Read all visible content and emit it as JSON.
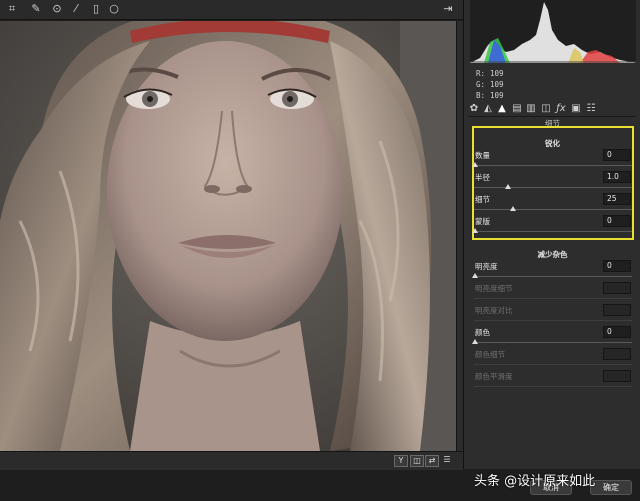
{
  "toolbar": {
    "tools": [
      "crop-icon",
      "eyedropper-icon",
      "red-eye-icon",
      "brush-icon",
      "gradient-icon",
      "radial-filter-icon"
    ],
    "export_icon": "export-icon"
  },
  "readout": {
    "r_label": "R:",
    "r_value": "109",
    "g_label": "G:",
    "g_value": "109",
    "b_label": "B:",
    "b_value": "109"
  },
  "panel": {
    "heading": "细节",
    "tabs": [
      "basic-icon",
      "tone-curve-icon",
      "detail-icon",
      "hsl-icon",
      "split-toning-icon",
      "lens-icon",
      "fx-icon",
      "camera-calibration-icon",
      "presets-icon"
    ]
  },
  "sharpening": {
    "title": "锐化",
    "params": [
      {
        "label": "数量",
        "value": "0",
        "level": 0.0
      },
      {
        "label": "半径",
        "value": "1.0",
        "level": 0.22
      },
      {
        "label": "细节",
        "value": "25",
        "level": 0.25
      },
      {
        "label": "蒙版",
        "value": "0",
        "level": 0.0
      }
    ]
  },
  "noise_reduction": {
    "title": "减少杂色",
    "params": [
      {
        "label": "明亮度",
        "value": "0",
        "level": 0.0,
        "enabled": true
      },
      {
        "label": "明亮度细节",
        "value": "",
        "enabled": false
      },
      {
        "label": "明亮度对比",
        "value": "",
        "enabled": false
      },
      {
        "label": "颜色",
        "value": "0",
        "level": 0.0,
        "enabled": true
      },
      {
        "label": "颜色细节",
        "value": "",
        "enabled": false
      },
      {
        "label": "颜色平滑度",
        "value": "",
        "enabled": false
      }
    ]
  },
  "statusbar": {
    "preview_toggle": "Y"
  },
  "buttons": {
    "cancel": "取消",
    "ok": "确定"
  },
  "watermark": "头条 @设计原来如此",
  "colors": {
    "highlight_box": "#e9e033",
    "panel_bg": "#2d2d2d"
  }
}
